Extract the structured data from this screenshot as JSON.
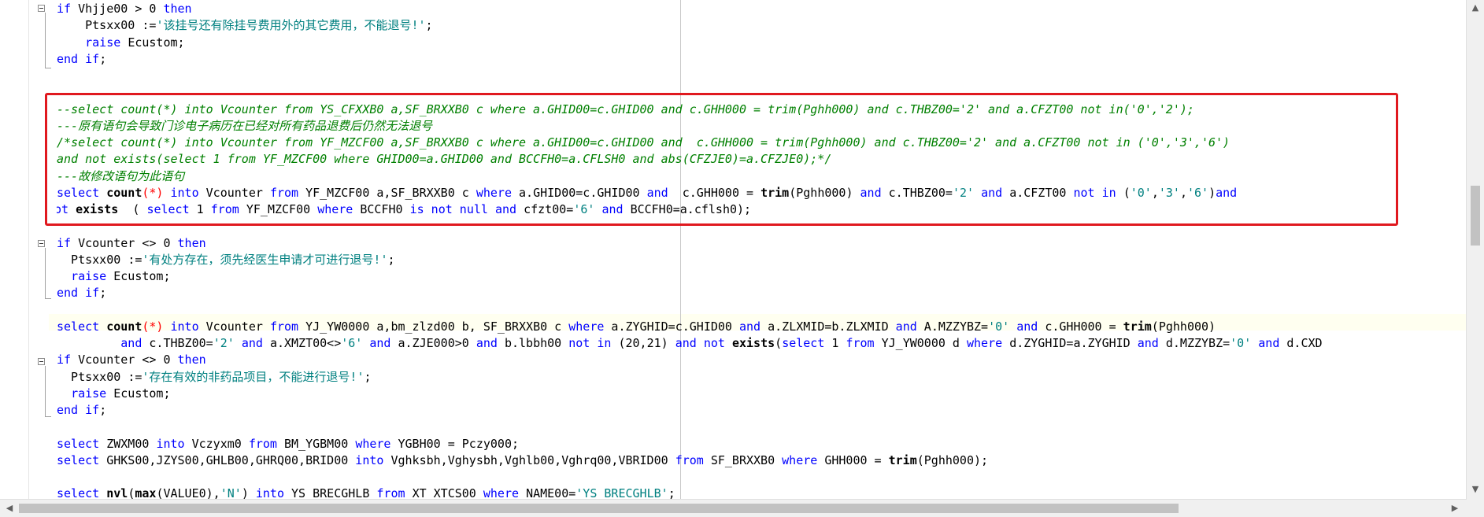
{
  "editor": {
    "lines": [
      [
        [
          "if ",
          "kw"
        ],
        [
          "Vhjje00 ",
          ""
        ],
        [
          "> ",
          ""
        ],
        [
          "0 ",
          ""
        ],
        [
          "then",
          "kw"
        ]
      ],
      [
        [
          "    Ptsxx00 ",
          ""
        ],
        [
          ":=",
          ""
        ],
        [
          "'该挂号还有除挂号费用外的其它费用，不能退号!'",
          "str"
        ],
        [
          ";",
          ""
        ]
      ],
      [
        [
          "    ",
          ""
        ],
        [
          "raise ",
          "kw"
        ],
        [
          "Ecustom;",
          ""
        ]
      ],
      [
        [
          "end if",
          "kw"
        ],
        [
          ";",
          ""
        ]
      ],
      [
        [
          "",
          ""
        ]
      ],
      [
        [
          "",
          ""
        ]
      ],
      [
        [
          "--select count(*) into Vcounter from YS_CFXXB0 a,SF_BRXXB0 c where a.GHID00=c.GHID00 and c.GHH000 = trim(Pghh000) and c.THBZ00='2' and a.CFZT00 not in('0','2');",
          "cmt"
        ]
      ],
      [
        [
          "---原有语句会导致门诊电子病历在已经对所有药品退费后仍然无法退号",
          "cmt"
        ]
      ],
      [
        [
          "/*select count(*) into Vcounter from YF_MZCF00 a,SF_BRXXB0 c where a.GHID00=c.GHID00 and  c.GHH000 = trim(Pghh000) and c.THBZ00='2' and a.CFZT00 not in ('0','3','6')",
          "cmt"
        ]
      ],
      [
        [
          "and not exists(select 1 from YF_MZCF00 where GHID00=a.GHID00 and BCCFH0=a.CFLSH0 and abs(CFZJE0)=a.CFZJE0);*/",
          "cmt"
        ]
      ],
      [
        [
          "---故修改语句为此语句",
          "cmt"
        ]
      ],
      [
        [
          "select ",
          "kw"
        ],
        [
          "count",
          "fn"
        ],
        [
          "(*) ",
          "op"
        ],
        [
          "into ",
          "kw"
        ],
        [
          "Vcounter ",
          ""
        ],
        [
          "from ",
          "kw"
        ],
        [
          "YF_MZCF00 a,SF_BRXXB0 c ",
          ""
        ],
        [
          "where ",
          "kw"
        ],
        [
          "a.GHID00=c.GHID00 ",
          ""
        ],
        [
          "and ",
          "kw"
        ],
        [
          " c.GHH000 = ",
          ""
        ],
        [
          "trim",
          "fn"
        ],
        [
          "(Pghh000) ",
          ""
        ],
        [
          "and ",
          "kw"
        ],
        [
          "c.THBZ00=",
          ""
        ],
        [
          "'2' ",
          "str"
        ],
        [
          "and ",
          "kw"
        ],
        [
          "a.CFZT00 ",
          ""
        ],
        [
          "not in ",
          "kw"
        ],
        [
          "(",
          ""
        ],
        [
          "'0'",
          "str"
        ],
        [
          ",",
          ""
        ],
        [
          "'3'",
          "str"
        ],
        [
          ",",
          ""
        ],
        [
          "'6'",
          "str"
        ],
        [
          ")",
          ""
        ],
        [
          "and",
          "kw"
        ]
      ],
      [
        [
          "not ",
          "kw"
        ],
        [
          "exists ",
          "fn"
        ],
        [
          " ( ",
          ""
        ],
        [
          "select ",
          "kw"
        ],
        [
          "1 ",
          ""
        ],
        [
          "from ",
          "kw"
        ],
        [
          "YF_MZCF00 ",
          ""
        ],
        [
          "where ",
          "kw"
        ],
        [
          "BCCFH0 ",
          ""
        ],
        [
          "is not null ",
          "kw"
        ],
        [
          "and ",
          "kw"
        ],
        [
          "cfzt00=",
          ""
        ],
        [
          "'6' ",
          "str"
        ],
        [
          "and ",
          "kw"
        ],
        [
          "BCCFH0=a.cflsh0);",
          ""
        ]
      ],
      [
        [
          "",
          ""
        ]
      ],
      [
        [
          "if ",
          "kw"
        ],
        [
          "Vcounter ",
          ""
        ],
        [
          "<> 0 ",
          ""
        ],
        [
          "then",
          "kw"
        ]
      ],
      [
        [
          "  Ptsxx00 ",
          ""
        ],
        [
          ":=",
          ""
        ],
        [
          "'有处方存在，须先经医生申请才可进行退号!'",
          "str"
        ],
        [
          ";",
          ""
        ]
      ],
      [
        [
          "  ",
          ""
        ],
        [
          "raise ",
          "kw"
        ],
        [
          "Ecustom;",
          ""
        ]
      ],
      [
        [
          "end if",
          "kw"
        ],
        [
          ";",
          ""
        ]
      ],
      [
        [
          "",
          ""
        ]
      ],
      [
        [
          "select ",
          "kw"
        ],
        [
          "count",
          "fn"
        ],
        [
          "(*) ",
          "op"
        ],
        [
          "into ",
          "kw"
        ],
        [
          "Vcounter ",
          ""
        ],
        [
          "from ",
          "kw"
        ],
        [
          "YJ_YW0000 a,bm_zlzd00 b, SF_BRXXB0 c ",
          ""
        ],
        [
          "where ",
          "kw"
        ],
        [
          "a.ZYGHID=c.GHID00 ",
          ""
        ],
        [
          "and ",
          "kw"
        ],
        [
          "a.ZLXMID=b.ZLXMID ",
          ""
        ],
        [
          "and ",
          "kw"
        ],
        [
          "A.MZZYBZ=",
          ""
        ],
        [
          "'0' ",
          "str"
        ],
        [
          "and ",
          "kw"
        ],
        [
          "c.GHH000 = ",
          ""
        ],
        [
          "trim",
          "fn"
        ],
        [
          "(Pghh000)",
          ""
        ]
      ],
      [
        [
          "         ",
          ""
        ],
        [
          "and ",
          "kw"
        ],
        [
          "c.THBZ00=",
          ""
        ],
        [
          "'2' ",
          "str"
        ],
        [
          "and ",
          "kw"
        ],
        [
          "a.XMZT00<>",
          ""
        ],
        [
          "'6' ",
          "str"
        ],
        [
          "and ",
          "kw"
        ],
        [
          "a.ZJE000>0 ",
          ""
        ],
        [
          "and ",
          "kw"
        ],
        [
          "b.lbbh00 ",
          ""
        ],
        [
          "not in ",
          "kw"
        ],
        [
          "(20,21) ",
          ""
        ],
        [
          "and not ",
          "kw"
        ],
        [
          "exists",
          "fn"
        ],
        [
          "(",
          ""
        ],
        [
          "select ",
          "kw"
        ],
        [
          "1 ",
          ""
        ],
        [
          "from ",
          "kw"
        ],
        [
          "YJ_YW0000 d ",
          ""
        ],
        [
          "where ",
          "kw"
        ],
        [
          "d.ZYGHID=a.ZYGHID ",
          ""
        ],
        [
          "and ",
          "kw"
        ],
        [
          "d.MZZYBZ=",
          ""
        ],
        [
          "'0' ",
          "str"
        ],
        [
          "and ",
          "kw"
        ],
        [
          "d.CXD",
          ""
        ]
      ],
      [
        [
          "if ",
          "kw"
        ],
        [
          "Vcounter ",
          ""
        ],
        [
          "<> 0 ",
          ""
        ],
        [
          "then",
          "kw"
        ]
      ],
      [
        [
          "  Ptsxx00 ",
          ""
        ],
        [
          ":=",
          ""
        ],
        [
          "'存在有效的非药品项目，不能进行退号!'",
          "str"
        ],
        [
          ";",
          ""
        ]
      ],
      [
        [
          "  ",
          ""
        ],
        [
          "raise ",
          "kw"
        ],
        [
          "Ecustom;",
          ""
        ]
      ],
      [
        [
          "end if",
          "kw"
        ],
        [
          ";",
          ""
        ]
      ],
      [
        [
          "",
          ""
        ]
      ],
      [
        [
          "select ",
          "kw"
        ],
        [
          "ZWXM00 ",
          ""
        ],
        [
          "into ",
          "kw"
        ],
        [
          "Vczyxm0 ",
          ""
        ],
        [
          "from ",
          "kw"
        ],
        [
          "BM_YGBM00 ",
          ""
        ],
        [
          "where ",
          "kw"
        ],
        [
          "YGBH00 = Pczy000;",
          ""
        ]
      ],
      [
        [
          "select ",
          "kw"
        ],
        [
          "GHKS00,JZYS00,GHLB00,GHRQ00,BRID00 ",
          ""
        ],
        [
          "into ",
          "kw"
        ],
        [
          "Vghksbh,Vghysbh,Vghlb00,Vghrq00,VBRID00 ",
          ""
        ],
        [
          "from ",
          "kw"
        ],
        [
          "SF_BRXXB0 ",
          ""
        ],
        [
          "where ",
          "kw"
        ],
        [
          "GHH000 = ",
          ""
        ],
        [
          "trim",
          "fn"
        ],
        [
          "(Pghh000);",
          ""
        ]
      ],
      [
        [
          "",
          ""
        ]
      ],
      [
        [
          "select ",
          "kw"
        ],
        [
          "nvl",
          "fn"
        ],
        [
          "(",
          ""
        ],
        [
          "max",
          "fn"
        ],
        [
          "(VALUE0),",
          ""
        ],
        [
          "'N'",
          "str"
        ],
        [
          ") ",
          ""
        ],
        [
          "into ",
          "kw"
        ],
        [
          "YS_BRECGHLB ",
          ""
        ],
        [
          "from ",
          "kw"
        ],
        [
          "XT_XTCS00 ",
          ""
        ],
        [
          "where ",
          "kw"
        ],
        [
          "NAME00=",
          ""
        ],
        [
          "'YS_BRECGHLB'",
          "str"
        ],
        [
          ";",
          ""
        ]
      ]
    ]
  }
}
